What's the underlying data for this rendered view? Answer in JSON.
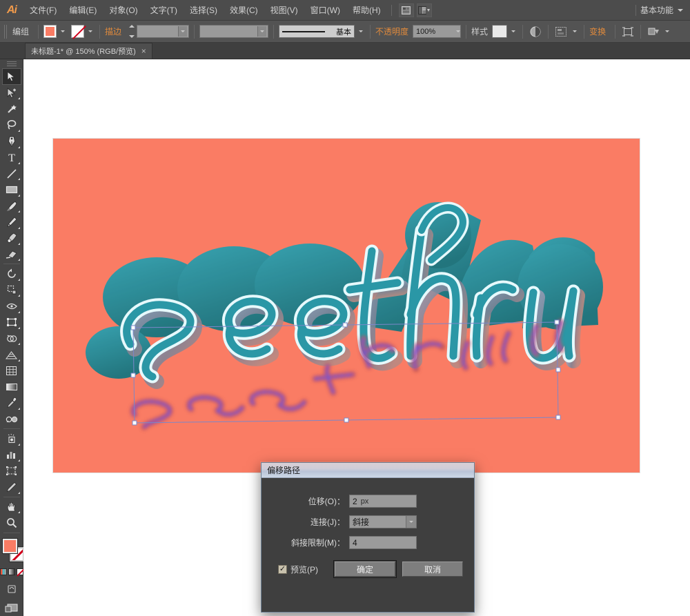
{
  "app": {
    "name": "Adobe Illustrator",
    "logo": "Ai"
  },
  "menubar": {
    "items": [
      {
        "label": "文件(F)",
        "name": "menu-file"
      },
      {
        "label": "编辑(E)",
        "name": "menu-edit"
      },
      {
        "label": "对象(O)",
        "name": "menu-object"
      },
      {
        "label": "文字(T)",
        "name": "menu-type"
      },
      {
        "label": "选择(S)",
        "name": "menu-select"
      },
      {
        "label": "效果(C)",
        "name": "menu-effect"
      },
      {
        "label": "视图(V)",
        "name": "menu-view"
      },
      {
        "label": "窗口(W)",
        "name": "menu-window"
      },
      {
        "label": "帮助(H)",
        "name": "menu-help"
      }
    ],
    "workspace": "基本功能"
  },
  "controlbar": {
    "selection_label": "编组",
    "fill_color": "#fa7c64",
    "stroke_label": "描边",
    "stroke_weight": "",
    "stroke_profile": "",
    "brush_label": "基本",
    "opacity_label": "不透明度",
    "opacity_value": "100%",
    "style_label": "样式",
    "transform_label": "变换"
  },
  "tabbar": {
    "document_title": "未标题-1* @ 150% (RGB/预览)",
    "close_glyph": "×"
  },
  "toolbar": {
    "tools": [
      {
        "name": "selection-tool",
        "label": "选择工具"
      },
      {
        "name": "direct-selection-tool",
        "label": "直接选择工具"
      },
      {
        "name": "magic-wand-tool",
        "label": "魔棒工具"
      },
      {
        "name": "lasso-tool",
        "label": "套索工具"
      },
      {
        "name": "pen-tool",
        "label": "钢笔工具"
      },
      {
        "name": "type-tool",
        "label": "文字工具"
      },
      {
        "name": "line-segment-tool",
        "label": "直线段工具"
      },
      {
        "name": "rectangle-tool",
        "label": "矩形工具"
      },
      {
        "name": "paintbrush-tool",
        "label": "画笔工具"
      },
      {
        "name": "pencil-tool",
        "label": "铅笔工具"
      },
      {
        "name": "blob-brush-tool",
        "label": "斑点画笔工具"
      },
      {
        "name": "eraser-tool",
        "label": "橡皮擦工具"
      },
      {
        "name": "rotate-tool",
        "label": "旋转工具"
      },
      {
        "name": "scale-tool",
        "label": "比例缩放工具"
      },
      {
        "name": "width-tool",
        "label": "宽度工具"
      },
      {
        "name": "free-transform-tool",
        "label": "自由变换工具"
      },
      {
        "name": "shape-builder-tool",
        "label": "形状生成器工具"
      },
      {
        "name": "perspective-grid-tool",
        "label": "透视网格工具"
      },
      {
        "name": "mesh-tool",
        "label": "网格工具"
      },
      {
        "name": "gradient-tool",
        "label": "渐变工具"
      },
      {
        "name": "eyedropper-tool",
        "label": "吸管工具"
      },
      {
        "name": "blend-tool",
        "label": "混合工具"
      },
      {
        "name": "symbol-sprayer-tool",
        "label": "符号喷枪工具"
      },
      {
        "name": "column-graph-tool",
        "label": "柱形图工具"
      },
      {
        "name": "artboard-tool",
        "label": "画板工具"
      },
      {
        "name": "slice-tool",
        "label": "切片工具"
      },
      {
        "name": "hand-tool",
        "label": "抓手工具"
      },
      {
        "name": "zoom-tool",
        "label": "缩放工具"
      }
    ],
    "fill_color": "#fa7c64",
    "stroke_color": "none"
  },
  "canvas": {
    "artboard_color": "#fa7c64",
    "artwork_text_1": "see",
    "artwork_text_2": "thru",
    "artwork_fill": "#2f9fae",
    "artwork_shadow": "#1d7f8d",
    "artwork_highlight": "#d8f4f7",
    "selection_color": "#7b87c9",
    "zoom_level": "150%"
  },
  "dialog": {
    "title": "偏移路径",
    "fields": [
      {
        "label": "位移(O)：",
        "value": "2",
        "unit": "px",
        "name": "offset-field"
      },
      {
        "label": "连接(J)：",
        "value": "斜接",
        "name": "join-select"
      },
      {
        "label": "斜接限制(M)：",
        "value": "4",
        "name": "miter-limit-field"
      }
    ],
    "preview_label": "预览(P)",
    "preview_checked": true,
    "check_glyph": "✓",
    "ok_label": "确定",
    "cancel_label": "取消"
  }
}
